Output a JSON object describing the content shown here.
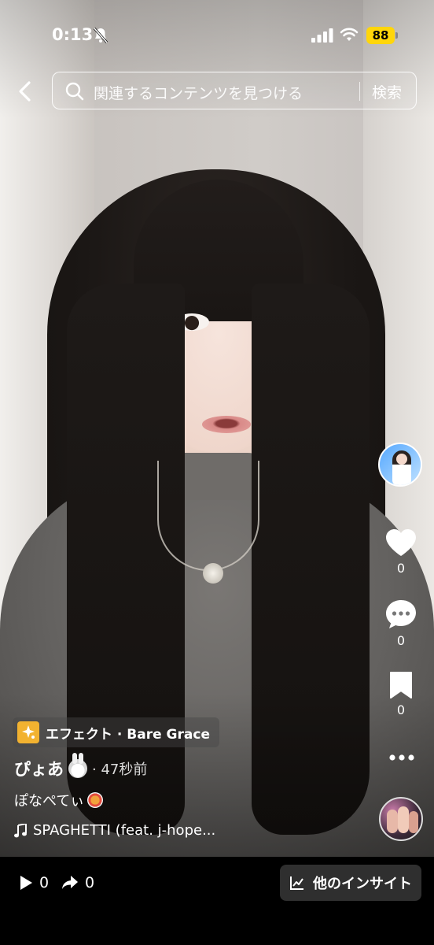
{
  "status_bar": {
    "time": "0:13",
    "battery": "88"
  },
  "header": {
    "search_placeholder": "関連するコンテンツを見つける",
    "search_button": "検索"
  },
  "rail": {
    "likes": "0",
    "comments": "0",
    "bookmarks": "0"
  },
  "post": {
    "effect_label": "エフェクト · Bare Grace",
    "author": "ぴょあ",
    "time_ago": "· 47秒前",
    "caption": "ぽなぺてぃ",
    "music": "SPAGHETTI (feat. j-hope..."
  },
  "bottom_bar": {
    "plays": "0",
    "shares": "0",
    "insight_button": "他のインサイト"
  },
  "colors": {
    "battery": "#ffd60a",
    "effect_icon": "#f2b230",
    "insight_bg": "#2f2f2f"
  }
}
